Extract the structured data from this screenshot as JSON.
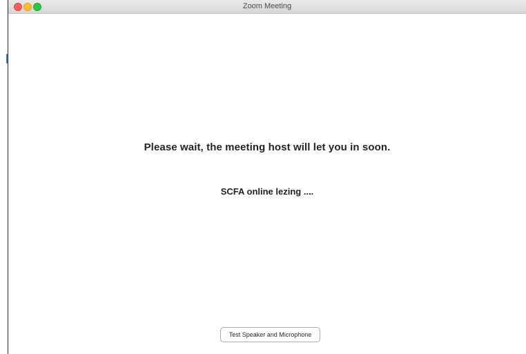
{
  "window": {
    "title": "Zoom Meeting"
  },
  "main": {
    "wait_message": "Please wait, the meeting host will let you in soon.",
    "meeting_topic": "SCFA online lezing ...."
  },
  "footer": {
    "test_button_label": "Test Speaker and Microphone"
  },
  "colors": {
    "close": "#fe5f57",
    "minimize": "#febc2e",
    "maximize": "#28c840"
  }
}
